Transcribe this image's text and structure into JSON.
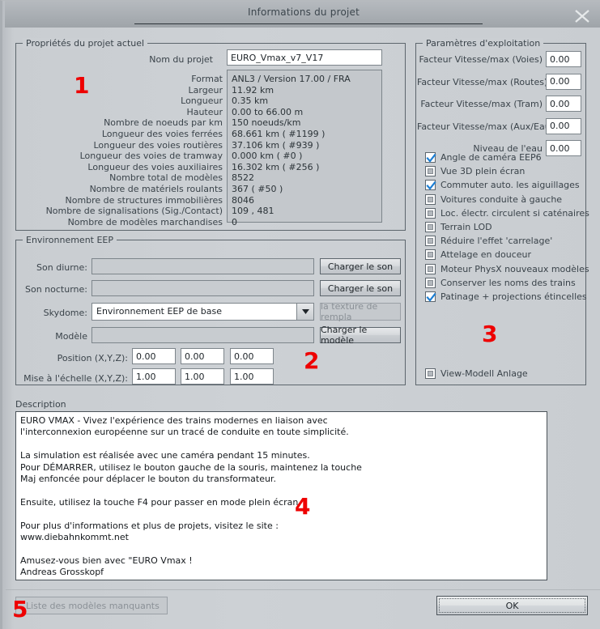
{
  "window": {
    "title": "Informations du projet",
    "close_icon": "close-x-icon"
  },
  "project_properties": {
    "legend": "Propriétés du projet actuel",
    "name_label": "Nom du projet",
    "name_value": "EURO_Vmax_v7_V17",
    "rows": [
      {
        "label": "Format",
        "value": "ANL3 / Version 17.00 / FRA"
      },
      {
        "label": "Largeur",
        "value": "11.92 km"
      },
      {
        "label": "Longueur",
        "value": "0.35 km"
      },
      {
        "label": "Hauteur",
        "value": "0.00 to 66.00 m"
      },
      {
        "label": "Nombre de noeuds par km",
        "value": "150  noeuds/km"
      },
      {
        "label": "Longueur des voies ferrées",
        "value": "68.661 km ( #1199 )"
      },
      {
        "label": "Longueur des voies routières",
        "value": "37.106 km ( #939 )"
      },
      {
        "label": "Longueur des voies de tramway",
        "value": "0.000 km ( #0 )"
      },
      {
        "label": "Longueur des voies auxiliaires",
        "value": "16.302 km ( #256 )"
      },
      {
        "label": "Nombre total de modèles",
        "value": "8522"
      },
      {
        "label": "Nombre de matériels roulants",
        "value": "367 ( #50 )"
      },
      {
        "label": "Nombre de structures immobilières",
        "value": "8046"
      },
      {
        "label": "Nombre de signalisations (Sig./Contact)",
        "value": "109 , 481"
      },
      {
        "label": "Nombre de modèles marchandises",
        "value": "0"
      }
    ],
    "marker": "1"
  },
  "operating_parameters": {
    "legend": "Paramètres d'exploitation",
    "fields": [
      {
        "label": "Facteur Vitesse/max (Voies)",
        "value": "0.00"
      },
      {
        "label": "Facteur Vitesse/max (Routes)",
        "value": "0.00"
      },
      {
        "label": "Facteur Vitesse/max (Tram)",
        "value": "0.00"
      },
      {
        "label": "Facteur Vitesse/max (Aux/Eau)",
        "value": "0.00"
      },
      {
        "label": "Niveau de l'eau",
        "value": "0.00"
      }
    ],
    "checkboxes": [
      {
        "label": "Angle de caméra EEP6",
        "checked": true
      },
      {
        "label": "Vue 3D plein écran",
        "checked": false
      },
      {
        "label": "Commuter auto. les aiguillages",
        "checked": true
      },
      {
        "label": "Voitures conduite à gauche",
        "checked": false
      },
      {
        "label": "Loc. électr. circulent si caténaires",
        "checked": false
      },
      {
        "label": "Terrain LOD",
        "checked": false
      },
      {
        "label": "Réduire l'effet 'carrelage'",
        "checked": false
      },
      {
        "label": "Attelage en douceur",
        "checked": false
      },
      {
        "label": "Moteur PhysX nouveaux modèles",
        "checked": false
      },
      {
        "label": "Conserver les noms des trains",
        "checked": false
      },
      {
        "label": "Patinage + projections étincelles",
        "checked": true
      }
    ],
    "view_model_checkbox": {
      "label": "View-Modell Anlage",
      "checked": false
    },
    "marker": "3"
  },
  "eep_environment": {
    "legend": "Environnement EEP",
    "day_sound_label": "Son diurne:",
    "day_sound_value": "",
    "day_sound_button": "Charger le son",
    "night_sound_label": "Son nocturne:",
    "night_sound_value": "",
    "night_sound_button": "Charger le son",
    "skydome_label": "Skydome:",
    "skydome_value": "Environnement EEP de base",
    "skydome_texture_button": "la texture de rempla",
    "model_label": "Modèle",
    "model_value": "",
    "model_button": "Charger le modèle",
    "position_label": "Position (X,Y,Z):",
    "position": [
      "0.00",
      "0.00",
      "0.00"
    ],
    "scale_label": "Mise à l'échelle (X,Y,Z):",
    "scale": [
      "1.00",
      "1.00",
      "1.00"
    ],
    "marker": "2"
  },
  "description": {
    "label": "Description",
    "text": "EURO VMAX - Vivez l'expérience des trains modernes en liaison avec\nl'interconnexion européenne sur un tracé de conduite en toute simplicité.\n\nLa simulation est réalisée avec une caméra pendant 15 minutes.\nPour DÉMARRER, utilisez le bouton gauche de la souris, maintenez la touche\nMaj enfoncée pour déplacer le bouton du transformateur.\n\nEnsuite, utilisez la touche F4 pour passer en mode plein écran.\n\nPour plus d'informations et plus de projets, visitez le site :\nwww.diebahnkommt.net\n\nAmusez-vous bien avec \"EURO Vmax !\nAndreas Grosskopf",
    "marker": "4"
  },
  "footer": {
    "missing_models_button": "Liste des modèles manquants",
    "ok_button": "OK",
    "marker": "5"
  },
  "colors": {
    "marker_red": "#ee0000",
    "check_blue": "#1d7fd4",
    "window_bg": "#cbcfd3",
    "border": "#5d666d"
  }
}
